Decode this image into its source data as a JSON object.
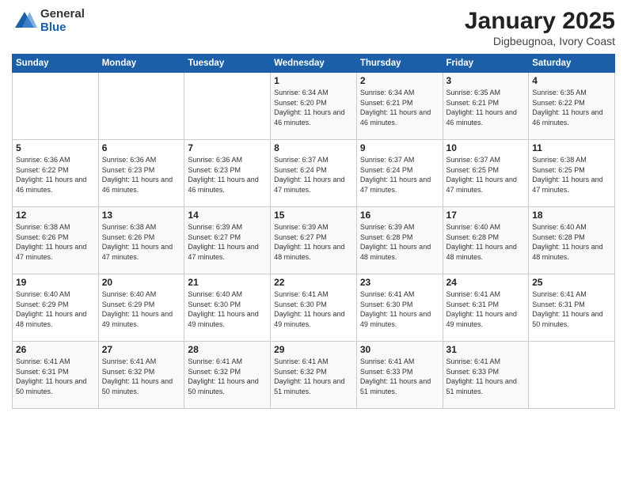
{
  "logo": {
    "general": "General",
    "blue": "Blue"
  },
  "title": "January 2025",
  "subtitle": "Digbeugnoa, Ivory Coast",
  "header_days": [
    "Sunday",
    "Monday",
    "Tuesday",
    "Wednesday",
    "Thursday",
    "Friday",
    "Saturday"
  ],
  "weeks": [
    [
      {
        "day": "",
        "info": ""
      },
      {
        "day": "",
        "info": ""
      },
      {
        "day": "",
        "info": ""
      },
      {
        "day": "1",
        "info": "Sunrise: 6:34 AM\nSunset: 6:20 PM\nDaylight: 11 hours and 46 minutes."
      },
      {
        "day": "2",
        "info": "Sunrise: 6:34 AM\nSunset: 6:21 PM\nDaylight: 11 hours and 46 minutes."
      },
      {
        "day": "3",
        "info": "Sunrise: 6:35 AM\nSunset: 6:21 PM\nDaylight: 11 hours and 46 minutes."
      },
      {
        "day": "4",
        "info": "Sunrise: 6:35 AM\nSunset: 6:22 PM\nDaylight: 11 hours and 46 minutes."
      }
    ],
    [
      {
        "day": "5",
        "info": "Sunrise: 6:36 AM\nSunset: 6:22 PM\nDaylight: 11 hours and 46 minutes."
      },
      {
        "day": "6",
        "info": "Sunrise: 6:36 AM\nSunset: 6:23 PM\nDaylight: 11 hours and 46 minutes."
      },
      {
        "day": "7",
        "info": "Sunrise: 6:36 AM\nSunset: 6:23 PM\nDaylight: 11 hours and 46 minutes."
      },
      {
        "day": "8",
        "info": "Sunrise: 6:37 AM\nSunset: 6:24 PM\nDaylight: 11 hours and 47 minutes."
      },
      {
        "day": "9",
        "info": "Sunrise: 6:37 AM\nSunset: 6:24 PM\nDaylight: 11 hours and 47 minutes."
      },
      {
        "day": "10",
        "info": "Sunrise: 6:37 AM\nSunset: 6:25 PM\nDaylight: 11 hours and 47 minutes."
      },
      {
        "day": "11",
        "info": "Sunrise: 6:38 AM\nSunset: 6:25 PM\nDaylight: 11 hours and 47 minutes."
      }
    ],
    [
      {
        "day": "12",
        "info": "Sunrise: 6:38 AM\nSunset: 6:26 PM\nDaylight: 11 hours and 47 minutes."
      },
      {
        "day": "13",
        "info": "Sunrise: 6:38 AM\nSunset: 6:26 PM\nDaylight: 11 hours and 47 minutes."
      },
      {
        "day": "14",
        "info": "Sunrise: 6:39 AM\nSunset: 6:27 PM\nDaylight: 11 hours and 47 minutes."
      },
      {
        "day": "15",
        "info": "Sunrise: 6:39 AM\nSunset: 6:27 PM\nDaylight: 11 hours and 48 minutes."
      },
      {
        "day": "16",
        "info": "Sunrise: 6:39 AM\nSunset: 6:28 PM\nDaylight: 11 hours and 48 minutes."
      },
      {
        "day": "17",
        "info": "Sunrise: 6:40 AM\nSunset: 6:28 PM\nDaylight: 11 hours and 48 minutes."
      },
      {
        "day": "18",
        "info": "Sunrise: 6:40 AM\nSunset: 6:28 PM\nDaylight: 11 hours and 48 minutes."
      }
    ],
    [
      {
        "day": "19",
        "info": "Sunrise: 6:40 AM\nSunset: 6:29 PM\nDaylight: 11 hours and 48 minutes."
      },
      {
        "day": "20",
        "info": "Sunrise: 6:40 AM\nSunset: 6:29 PM\nDaylight: 11 hours and 49 minutes."
      },
      {
        "day": "21",
        "info": "Sunrise: 6:40 AM\nSunset: 6:30 PM\nDaylight: 11 hours and 49 minutes."
      },
      {
        "day": "22",
        "info": "Sunrise: 6:41 AM\nSunset: 6:30 PM\nDaylight: 11 hours and 49 minutes."
      },
      {
        "day": "23",
        "info": "Sunrise: 6:41 AM\nSunset: 6:30 PM\nDaylight: 11 hours and 49 minutes."
      },
      {
        "day": "24",
        "info": "Sunrise: 6:41 AM\nSunset: 6:31 PM\nDaylight: 11 hours and 49 minutes."
      },
      {
        "day": "25",
        "info": "Sunrise: 6:41 AM\nSunset: 6:31 PM\nDaylight: 11 hours and 50 minutes."
      }
    ],
    [
      {
        "day": "26",
        "info": "Sunrise: 6:41 AM\nSunset: 6:31 PM\nDaylight: 11 hours and 50 minutes."
      },
      {
        "day": "27",
        "info": "Sunrise: 6:41 AM\nSunset: 6:32 PM\nDaylight: 11 hours and 50 minutes."
      },
      {
        "day": "28",
        "info": "Sunrise: 6:41 AM\nSunset: 6:32 PM\nDaylight: 11 hours and 50 minutes."
      },
      {
        "day": "29",
        "info": "Sunrise: 6:41 AM\nSunset: 6:32 PM\nDaylight: 11 hours and 51 minutes."
      },
      {
        "day": "30",
        "info": "Sunrise: 6:41 AM\nSunset: 6:33 PM\nDaylight: 11 hours and 51 minutes."
      },
      {
        "day": "31",
        "info": "Sunrise: 6:41 AM\nSunset: 6:33 PM\nDaylight: 11 hours and 51 minutes."
      },
      {
        "day": "",
        "info": ""
      }
    ]
  ]
}
